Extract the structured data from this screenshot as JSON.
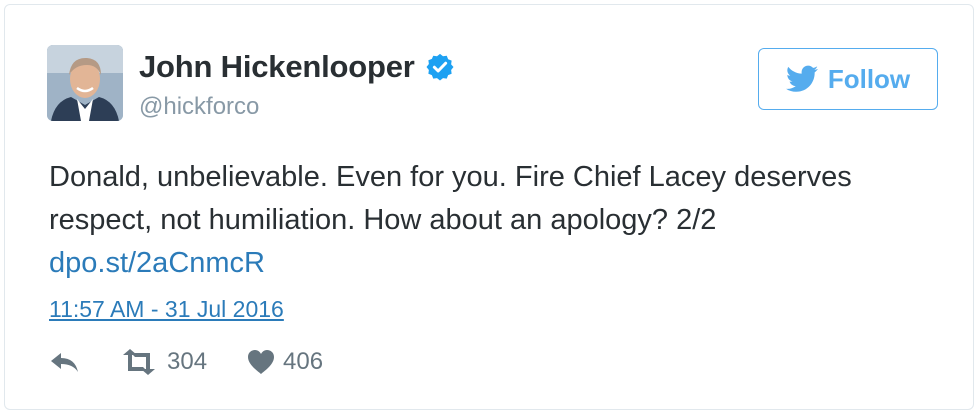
{
  "user": {
    "display_name": "John Hickenlooper",
    "handle": "@hickforco",
    "verified": true,
    "verified_icon": "verified-badge-icon",
    "avatar": "profile-photo"
  },
  "follow_button": {
    "label": "Follow",
    "icon": "twitter-bird-icon",
    "color": "#55acee"
  },
  "tweet": {
    "text_line_1": "Donald, unbelievable. Even for you. Fire Chief Lacey deserves",
    "text_line_2": "respect, not humiliation. How about an apology? 2/2",
    "link": "dpo.st/2aCnmcR",
    "timestamp": "11:57 AM - 31 Jul 2016"
  },
  "actions": {
    "reply_icon": "reply-icon",
    "retweet_icon": "retweet-icon",
    "retweet_count": "304",
    "like_icon": "heart-icon",
    "like_count": "406"
  },
  "colors": {
    "text": "#292f33",
    "muted": "#8899a6",
    "link": "#2b7bb9",
    "border": "#e1e8ed"
  }
}
